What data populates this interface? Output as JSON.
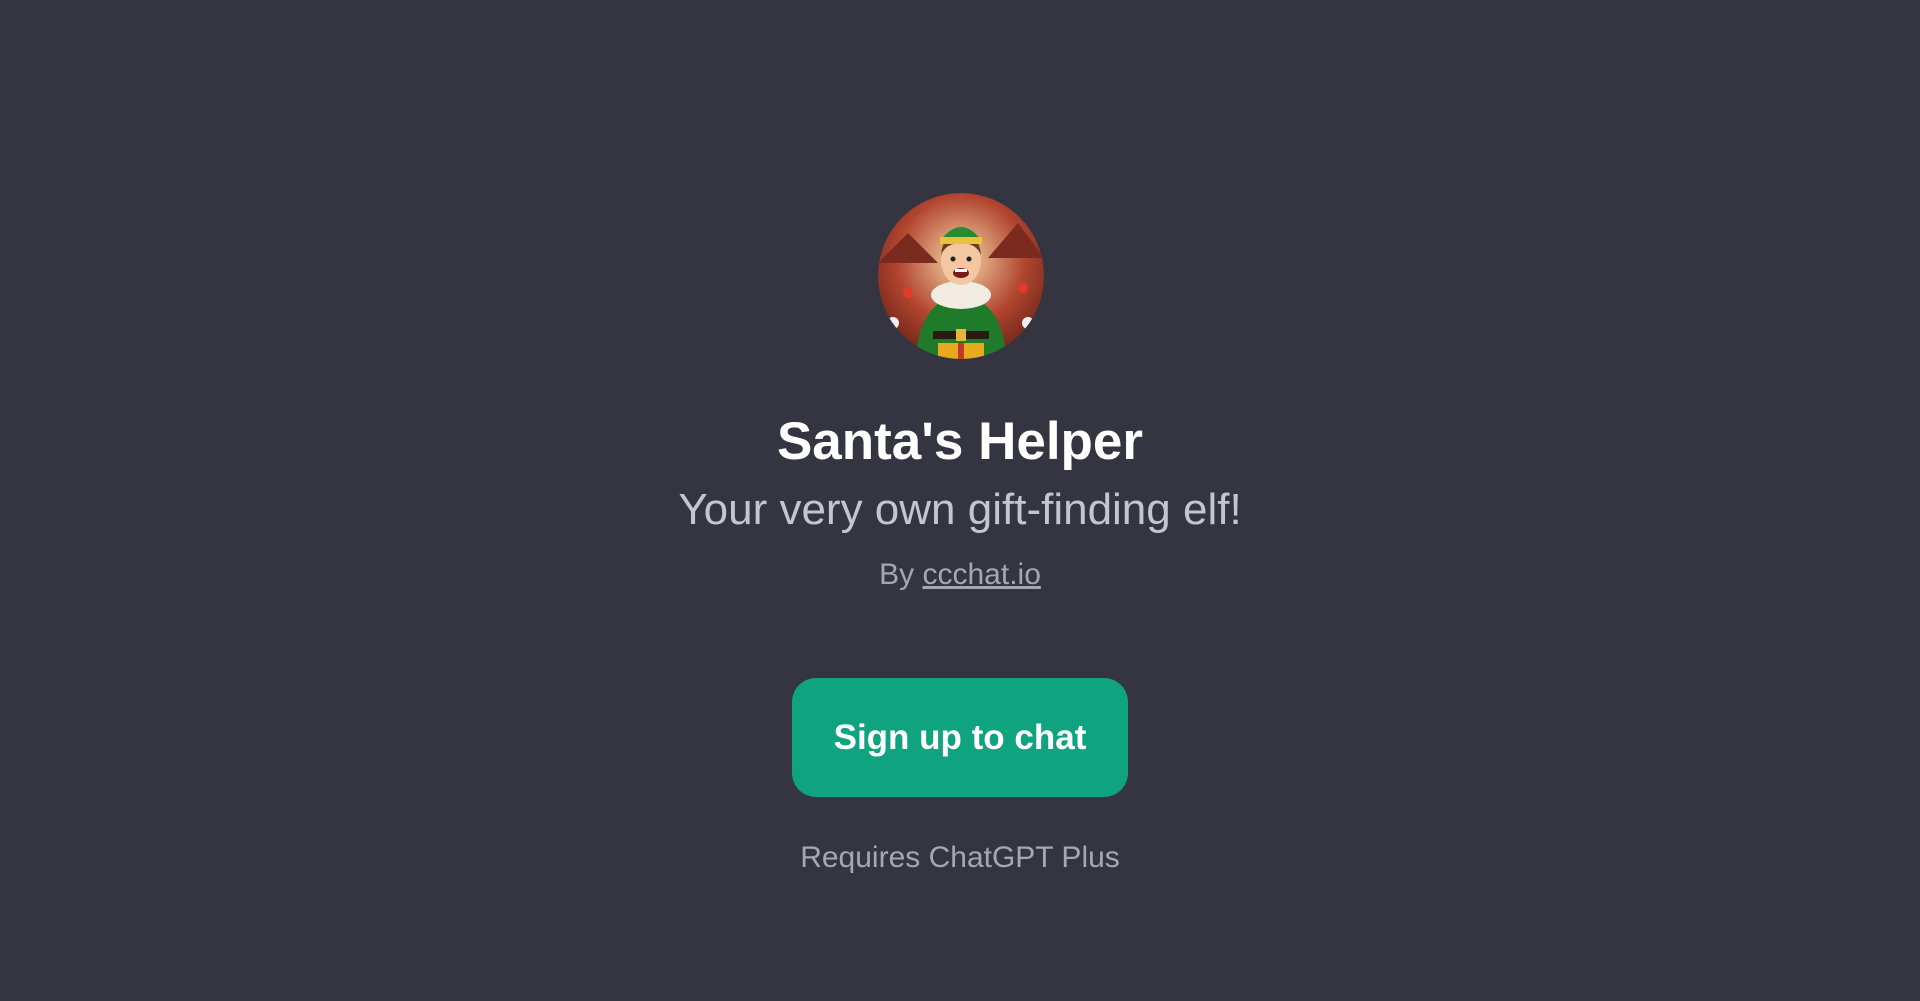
{
  "gpt": {
    "name": "Santa's Helper",
    "description": "Your very own gift-finding elf!",
    "by_prefix": "By",
    "author": "ccchat.io",
    "avatar_icon": "elf-avatar"
  },
  "cta": {
    "label": "Sign up to chat",
    "color": "#10a37f"
  },
  "requirement": "Requires ChatGPT Plus",
  "theme": {
    "background": "#343541"
  }
}
